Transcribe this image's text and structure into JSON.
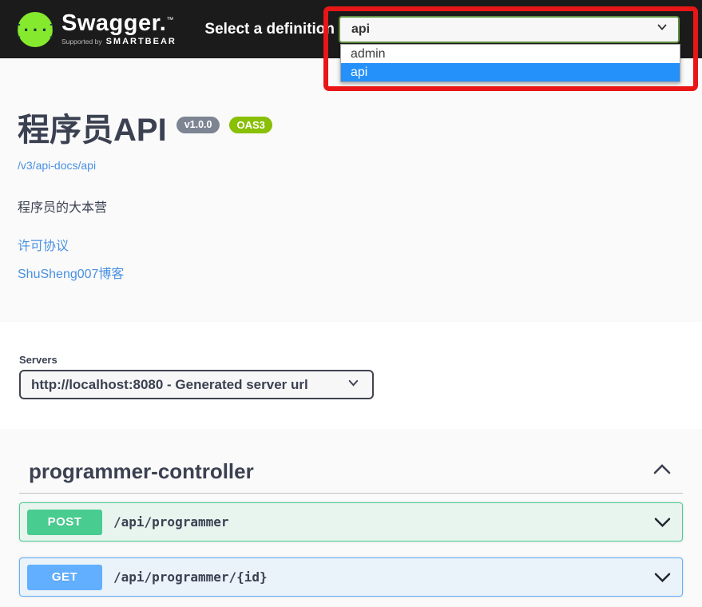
{
  "topbar": {
    "brand": "Swagger.",
    "brand_tm": "™",
    "supported_by": "Supported by",
    "supported_brand": "SMARTBEAR",
    "definition_label": "Select a definition",
    "definition_select": {
      "value": "api",
      "options": [
        "admin",
        "api"
      ],
      "selected_option": "api"
    }
  },
  "info": {
    "title": "程序员API",
    "version_badge": "v1.0.0",
    "oas_badge": "OAS3",
    "spec_url": "/v3/api-docs/api",
    "description": "程序员的大本营",
    "license_link": "许可协议",
    "contact_link": "ShuSheng007博客"
  },
  "servers": {
    "label": "Servers",
    "selected_url": "http://localhost:8080 - Generated server url"
  },
  "tag_section": {
    "tag_name": "programmer-controller",
    "operations": [
      {
        "method": "POST",
        "path": "/api/programmer"
      },
      {
        "method": "GET",
        "path": "/api/programmer/{id}"
      }
    ]
  },
  "colors": {
    "topbar_bg": "#1b1b1b",
    "swagger_logo_green": "#85ea2d",
    "select_border_green": "#5f8f3e",
    "post_green": "#49cc90",
    "get_blue": "#61affe",
    "oas_badge_green": "#89bf04",
    "version_badge_gray": "#7d8492",
    "link_blue": "#4990e2",
    "text_dark": "#3b4151",
    "annotation_red": "#e81616",
    "option_highlight_blue": "#2490fa"
  }
}
